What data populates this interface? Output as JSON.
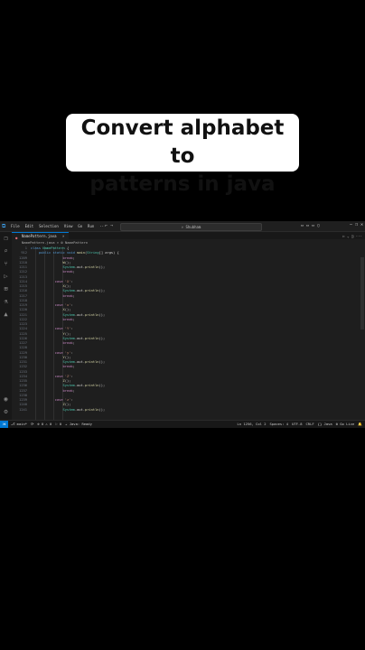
{
  "caption": {
    "line1": "Convert alphabet to",
    "line2": "patterns in java"
  },
  "titlebar": {
    "menu": [
      "File",
      "Edit",
      "Selection",
      "View",
      "Go",
      "Run",
      "···"
    ],
    "nav": "←  →",
    "search": "⌕ Shubham",
    "layout_icons": "▭ ▭ ▭ ▯",
    "window": [
      "—",
      "❐",
      "✕"
    ]
  },
  "tab": {
    "name": "NamePattern.java",
    "close": "×"
  },
  "editor_actions": "▷ ⌄  ◫  ···",
  "breadcrumb": "NamePattern.java  >  ⚙ NamePattern",
  "code_lines": [
    {
      "n": "1",
      "t": "class NamePattern {"
    },
    {
      "n": "912",
      "t": "    public static void main(String[] args) {"
    },
    {
      "n": "1209",
      "t": "                break;"
    },
    {
      "n": "1210",
      "t": "                W();"
    },
    {
      "n": "1211",
      "t": "                System.out.println();"
    },
    {
      "n": "1212",
      "t": "                break;"
    },
    {
      "n": "1213",
      "t": ""
    },
    {
      "n": "1214",
      "t": "            case 'X':"
    },
    {
      "n": "1215",
      "t": "                X();"
    },
    {
      "n": "1216",
      "t": "                System.out.println();"
    },
    {
      "n": "1217",
      "t": "                break;"
    },
    {
      "n": "1218",
      "t": ""
    },
    {
      "n": "1219",
      "t": "            case 'x':"
    },
    {
      "n": "1220",
      "t": "                X();"
    },
    {
      "n": "1221",
      "t": "                System.out.println();"
    },
    {
      "n": "1222",
      "t": "                break;"
    },
    {
      "n": "1223",
      "t": ""
    },
    {
      "n": "1224",
      "t": "            case 'Y':"
    },
    {
      "n": "1225",
      "t": "                Y();"
    },
    {
      "n": "1226",
      "t": "                System.out.println();"
    },
    {
      "n": "1227",
      "t": "                break;"
    },
    {
      "n": "1228",
      "t": ""
    },
    {
      "n": "1229",
      "t": "            case 'y':"
    },
    {
      "n": "1230",
      "t": "                Y();"
    },
    {
      "n": "1231",
      "t": "                System.out.println();"
    },
    {
      "n": "1232",
      "t": "                break;"
    },
    {
      "n": "1233",
      "t": ""
    },
    {
      "n": "1234",
      "t": "            case 'Z':"
    },
    {
      "n": "1235",
      "t": "                Z();"
    },
    {
      "n": "1236",
      "t": "                System.out.println();"
    },
    {
      "n": "1237",
      "t": "                break;"
    },
    {
      "n": "1238",
      "t": ""
    },
    {
      "n": "1239",
      "t": "            case 'z':"
    },
    {
      "n": "1240",
      "t": "                Z();"
    },
    {
      "n": "1241",
      "t": "                System.out.println();"
    }
  ],
  "statusbar": {
    "remote": "⋊",
    "left": [
      "⎇ main*",
      "⟳",
      "⊗ 0 ⚠ 0",
      "⚐ 0",
      "☕ Java: Ready"
    ],
    "right": [
      "Ln 1256, Col 2",
      "Spaces: 4",
      "UTF-8",
      "CRLF",
      "{} Java",
      "⚙ Go Live",
      "🔔"
    ]
  }
}
